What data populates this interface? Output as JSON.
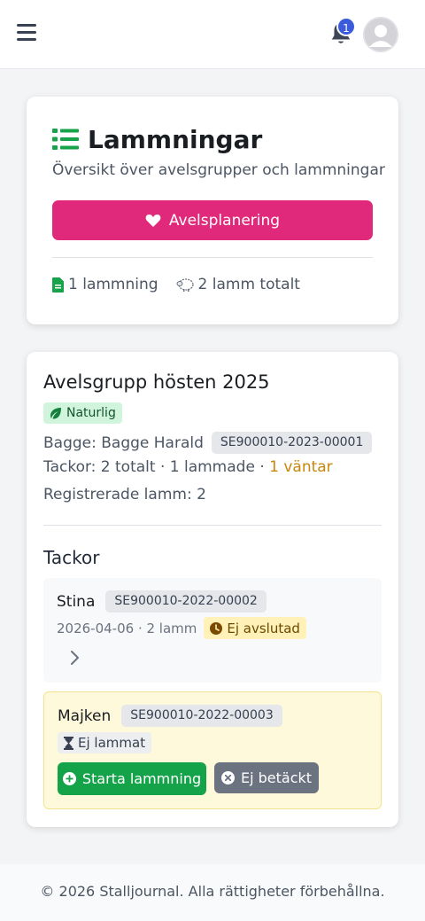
{
  "header": {
    "menu_icon": "hamburger-icon",
    "notifications_icon": "bell-icon",
    "notification_count": "1",
    "avatar_icon": "user-avatar"
  },
  "page": {
    "title": "Lammningar",
    "title_icon": "list-icon",
    "subtitle": "Översikt över avelsgrupper och lammningar",
    "primary_button": "Avelsplanering",
    "primary_button_icon": "heart-icon",
    "stats": {
      "lambings": "1 lammning",
      "lambs_total": "2 lamm totalt"
    }
  },
  "group": {
    "title": "Avelsgrupp hösten 2025",
    "method": "Naturlig",
    "ram_label": "Bagge: Bagge Harald",
    "ram_id": "SE900010-2023-00001",
    "ewes_summary": "Tackor: 2 totalt · 1 lammade · ",
    "ewes_waiting": "1 väntar",
    "registered_lambs": "Registrerade lamm: 2",
    "ewes_heading": "Tackor",
    "ewes": [
      {
        "name": "Stina",
        "id": "SE900010-2022-00002",
        "meta": "2026-04-06 · 2 lamm",
        "status": "Ej avslutad"
      },
      {
        "name": "Majken",
        "id": "SE900010-2022-00003",
        "status": "Ej lammat",
        "start_button": "Starta lammning",
        "not_covered_button": "Ej betäckt"
      }
    ]
  },
  "footer": {
    "text": "© 2026 Stalljournal. Alla rättigheter förbehållna."
  },
  "colors": {
    "accent_pink": "#e0297a",
    "success_green": "#15a34a",
    "warning_text": "#c8860a",
    "notification_badge": "#3b5bdb"
  }
}
